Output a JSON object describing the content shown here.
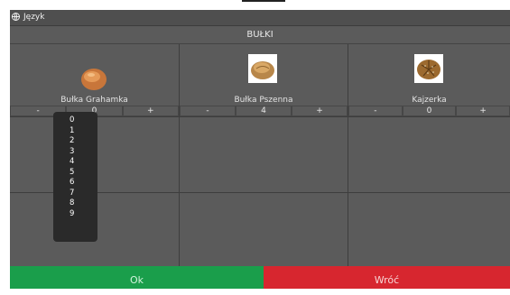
{
  "header": {
    "language_label": "Język",
    "category": "BUŁKI"
  },
  "products": [
    {
      "name": "Bułka Grahamka",
      "qty": "0",
      "minus": "-",
      "plus": "+",
      "image": "roll-graham-image"
    },
    {
      "name": "Bułka Pszenna",
      "qty": "4",
      "minus": "-",
      "plus": "+",
      "image": "wheat-roll-image"
    },
    {
      "name": "Kajzerka",
      "qty": "0",
      "minus": "-",
      "plus": "+",
      "image": "kaiser-roll-image"
    }
  ],
  "dropdown": {
    "options": [
      "0",
      "1",
      "2",
      "3",
      "4",
      "5",
      "6",
      "7",
      "8",
      "9"
    ]
  },
  "footer": {
    "ok_label": "Ok",
    "back_label": "Wróć"
  },
  "colors": {
    "ok": "#1a9e4b",
    "back": "#d7262f",
    "panel": "#5b5b5b"
  }
}
